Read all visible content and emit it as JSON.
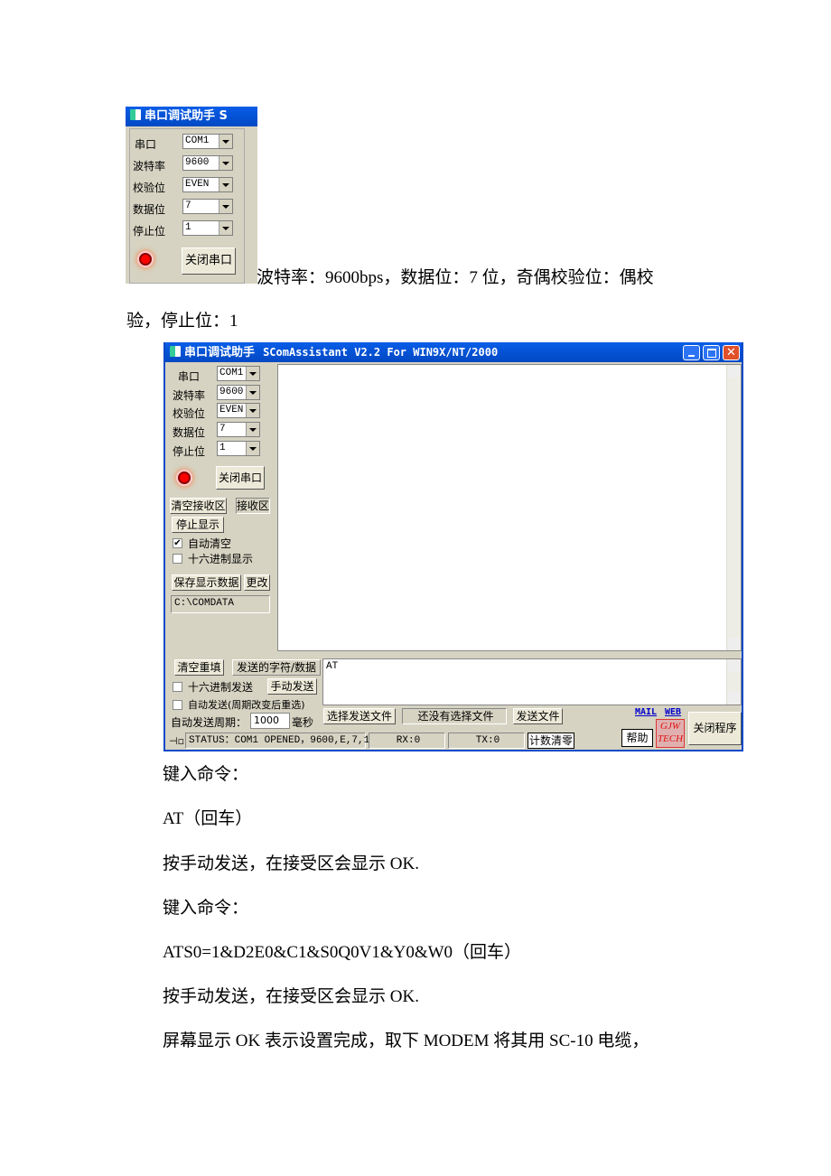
{
  "small_window": {
    "title": "串口调试助手  S",
    "labels": {
      "port": "串口",
      "baud": "波特率",
      "parity": "校验位",
      "data": "数据位",
      "stop": "停止位"
    },
    "values": {
      "port": "COM1",
      "baud": "9600",
      "parity": "EVEN",
      "data": "7",
      "stop": "1"
    },
    "close_port": "关闭串口"
  },
  "paragraph1_line1": "波特率：9600bps，数据位：7 位，奇偶校验位：偶校",
  "paragraph1_line2": "验，停止位：1",
  "big_window": {
    "title_cn": "串口调试助手",
    "title_en": "SComAssistant V2.2 For WIN9X/NT/2000",
    "labels": {
      "port": "串口",
      "baud": "波特率",
      "parity": "校验位",
      "data": "数据位",
      "stop": "停止位"
    },
    "values": {
      "port": "COM1",
      "baud": "9600",
      "parity": "EVEN",
      "data": "7",
      "stop": "1"
    },
    "close_port": "关闭串口",
    "clear_receive": "清空接收区",
    "receive_area_label": "接收区",
    "stop_display": "停止显示",
    "auto_clear": "自动清空",
    "auto_clear_checked": true,
    "hex_display": "十六进制显示",
    "hex_display_checked": false,
    "save_data": "保存显示数据",
    "change": "更改",
    "save_path": "C:\\COMDATA",
    "clear_refill": "清空重填",
    "send_label": "发送的字符/数据",
    "send_text": "AT",
    "hex_send": "十六进制发送",
    "hex_send_checked": false,
    "manual_send": "手动发送",
    "auto_send": "自动发送(周期改变后重选)",
    "auto_send_checked": false,
    "period_label": "自动发送周期：",
    "period_value": "1000",
    "period_unit": "毫秒",
    "choose_file": "选择发送文件",
    "no_file": "还没有选择文件",
    "send_file": "发送文件",
    "mail": "MAIL",
    "web": "WEB",
    "help": "帮助",
    "logo_line1": "GJW",
    "logo_line2": "TECH",
    "close_program": "关闭程序",
    "status": "STATUS：COM1 OPENED，9600,E,7,1",
    "rx": "RX:0",
    "tx": "TX:0",
    "reset_count": "计数清零"
  },
  "lines": [
    "键入命令：",
    "AT（回车）",
    "按手动发送，在接受区会显示 OK.",
    "键入命令：",
    "ATS0=1&D2E0&C1&S0Q0V1&Y0&W0（回车）",
    "按手动发送，在接受区会显示 OK.",
    "屏幕显示 OK 表示设置完成，取下 MODEM 将其用 SC-10 电缆，"
  ]
}
